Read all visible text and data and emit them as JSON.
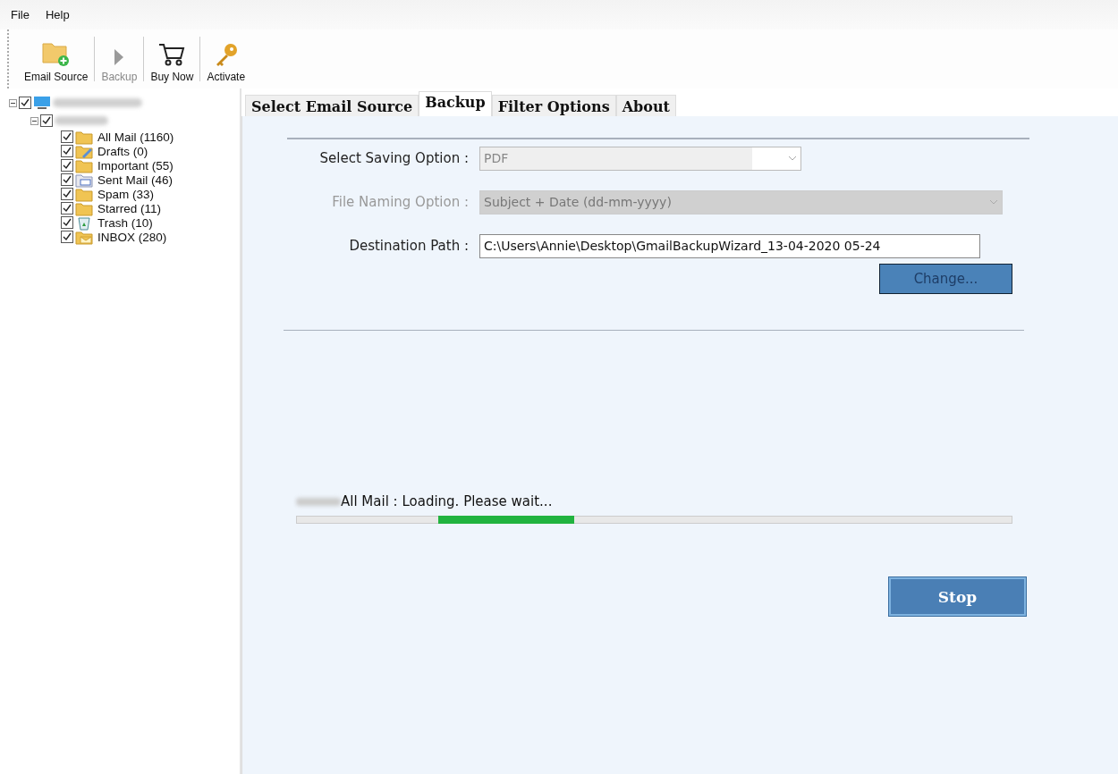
{
  "menu": [
    "File",
    "Help"
  ],
  "toolbar": [
    {
      "label": "Email Source",
      "kind": "folder-add",
      "disabled": false
    },
    {
      "label": "Backup",
      "kind": "play",
      "disabled": true
    },
    {
      "label": "Buy Now",
      "kind": "cart",
      "disabled": false
    },
    {
      "label": "Activate",
      "kind": "key",
      "disabled": false
    }
  ],
  "tree": {
    "checked": true,
    "expanded": true,
    "children": [
      {
        "checked": true,
        "expanded": true,
        "children": [
          {
            "label": "All Mail (1160)",
            "kind": "folder",
            "checked": true
          },
          {
            "label": "Drafts (0)",
            "kind": "drafts",
            "checked": true
          },
          {
            "label": "Important (55)",
            "kind": "folder",
            "checked": true
          },
          {
            "label": "Sent Mail (46)",
            "kind": "sent",
            "checked": true
          },
          {
            "label": "Spam (33)",
            "kind": "folder",
            "checked": true
          },
          {
            "label": "Starred (11)",
            "kind": "folder",
            "checked": true
          },
          {
            "label": "Trash (10)",
            "kind": "trash",
            "checked": true
          },
          {
            "label": "INBOX (280)",
            "kind": "inbox",
            "checked": true
          }
        ]
      }
    ]
  },
  "tabs": [
    {
      "label": "Select Email Source",
      "selected": false
    },
    {
      "label": "Backup",
      "selected": true
    },
    {
      "label": "Filter Options",
      "selected": false
    },
    {
      "label": "About",
      "selected": false
    }
  ],
  "form": [
    {
      "label": "Select Saving Option :",
      "kind": "select",
      "value": "PDF",
      "disabled": false
    },
    {
      "label": "File Naming Option :",
      "kind": "select",
      "value": "Subject + Date (dd-mm-yyyy)",
      "disabled": true
    },
    {
      "label": "Destination Path :",
      "kind": "text",
      "value": "C:\\Users\\Annie\\Desktop\\GmailBackupWizard_13-04-2020 05-24",
      "disabled": false
    }
  ],
  "change_button": "Change...",
  "progress": {
    "status": "All Mail : Loading. Please wait...",
    "level": 0.19
  },
  "stop_button": "Stop"
}
